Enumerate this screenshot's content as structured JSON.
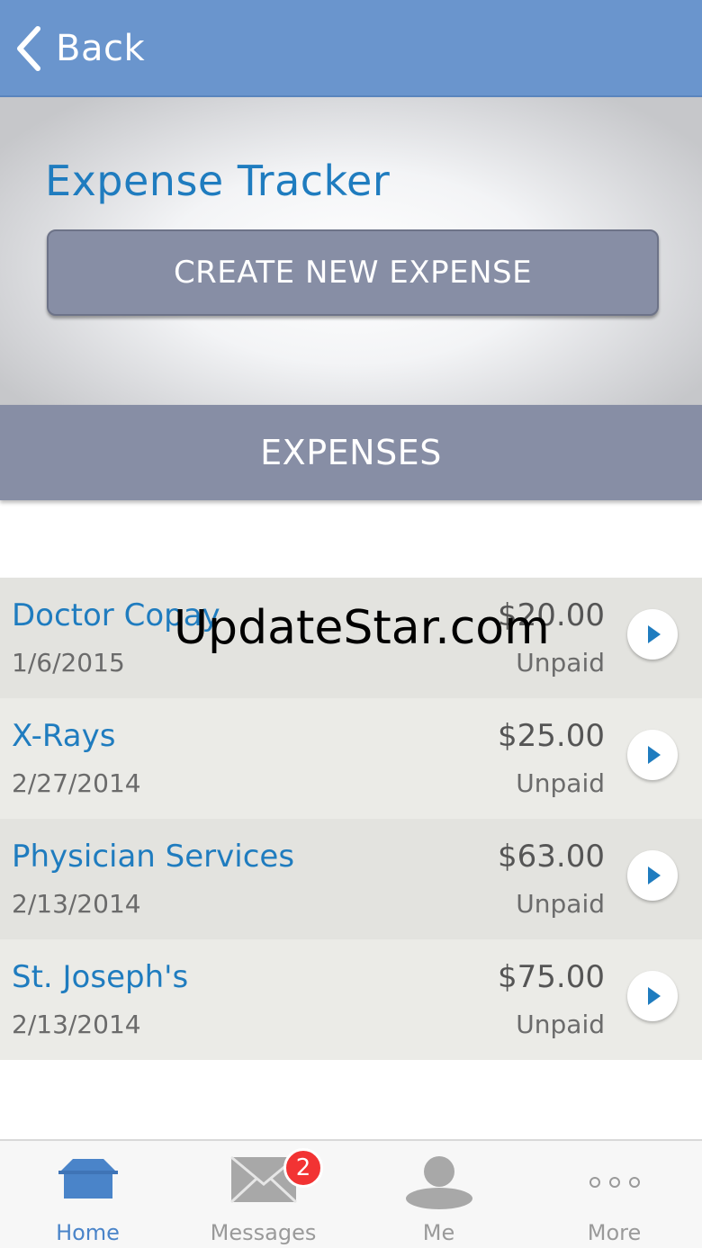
{
  "navbar": {
    "back_label": "Back"
  },
  "header": {
    "title": "Expense Tracker",
    "create_button_label": "CREATE NEW EXPENSE"
  },
  "section": {
    "title": "EXPENSES"
  },
  "expenses": [
    {
      "name": "Doctor Copay",
      "date": "1/6/2015",
      "amount": "$20.00",
      "status": "Unpaid"
    },
    {
      "name": "X-Rays",
      "date": "2/27/2014",
      "amount": "$25.00",
      "status": "Unpaid"
    },
    {
      "name": "Physician Services",
      "date": "2/13/2014",
      "amount": "$63.00",
      "status": "Unpaid"
    },
    {
      "name": "St. Joseph's",
      "date": "2/13/2014",
      "amount": "$75.00",
      "status": "Unpaid"
    }
  ],
  "watermark": "UpdateStar.com",
  "tabbar": {
    "tabs": [
      {
        "label": "Home",
        "icon": "home-icon",
        "active": true
      },
      {
        "label": "Messages",
        "icon": "envelope-icon",
        "badge": "2"
      },
      {
        "label": "Me",
        "icon": "person-icon"
      },
      {
        "label": "More",
        "icon": "more-dots-icon"
      }
    ]
  },
  "colors": {
    "navbar": "#6a95cd",
    "accent_blue": "#1f7cbf",
    "button_gray": "#878ea5",
    "badge_red": "#f23333",
    "active_tab": "#4a84c9"
  }
}
